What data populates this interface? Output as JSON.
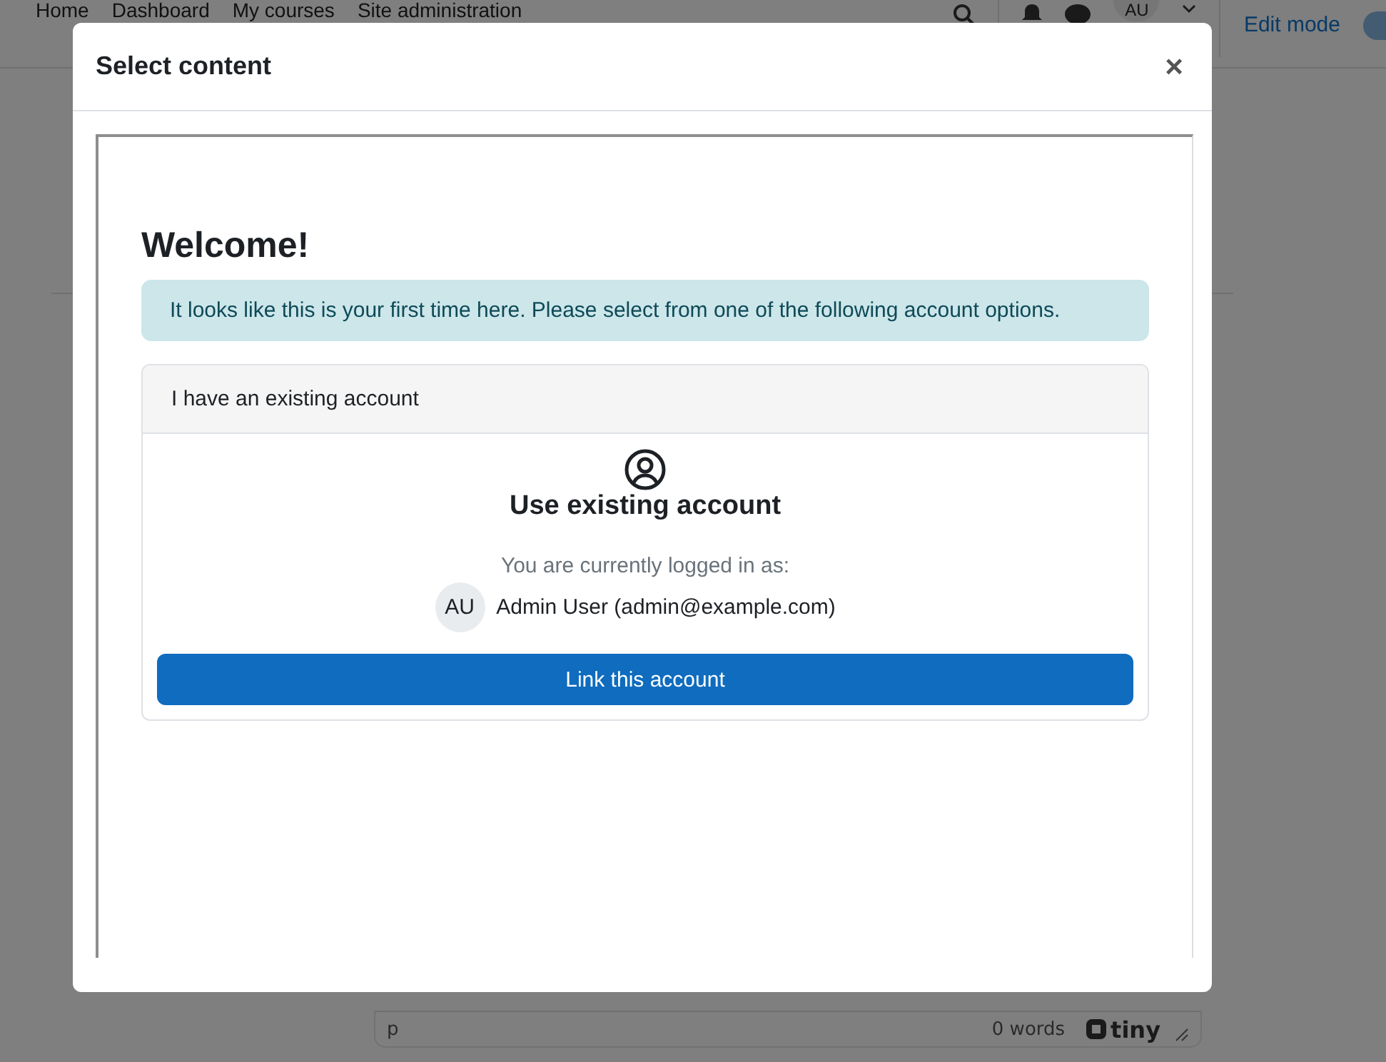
{
  "navbar": {
    "links": [
      "Home",
      "Dashboard",
      "My courses",
      "Site administration"
    ],
    "avatar": "AU",
    "edit_mode": {
      "label": "Edit mode",
      "on": false
    }
  },
  "editor": {
    "path": "p",
    "word_count": "0 words",
    "brand": "tiny"
  },
  "modal": {
    "title": "Select content",
    "close": "×",
    "heading": "Welcome!",
    "alert": "It looks like this is your first time here. Please select from one of the following account options.",
    "card": {
      "header": "I have an existing account",
      "title": "Use existing account",
      "logged_in_label": "You are currently logged in as:",
      "avatar": "AU",
      "user": "Admin User (admin@example.com)",
      "button": "Link this account"
    }
  }
}
